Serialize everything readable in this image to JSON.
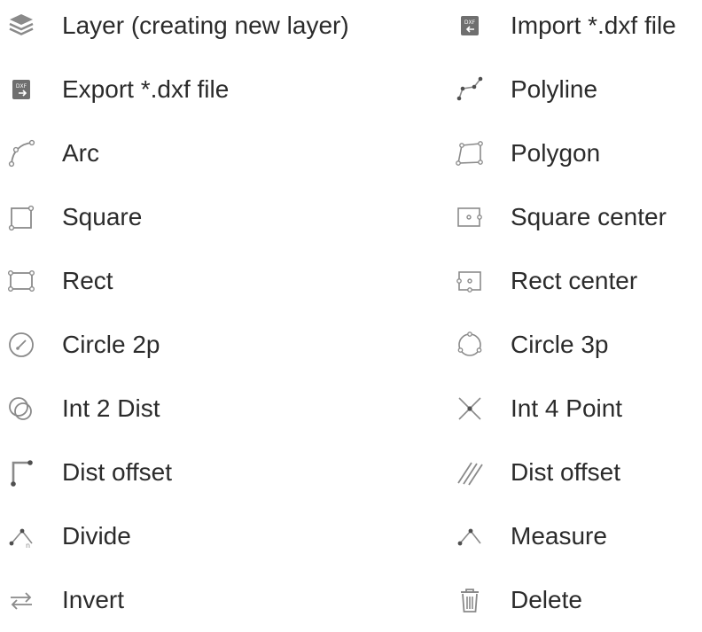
{
  "icon_color": "#8a8a8a",
  "menu": {
    "left": [
      {
        "label": "Layer (creating new layer)",
        "icon": "layers-icon"
      },
      {
        "label": "Export *.dxf file",
        "icon": "dxf-export-icon"
      },
      {
        "label": "Arc",
        "icon": "arc-icon"
      },
      {
        "label": "Square",
        "icon": "square-icon"
      },
      {
        "label": "Rect",
        "icon": "rect-icon"
      },
      {
        "label": "Circle 2p",
        "icon": "circle-2p-icon"
      },
      {
        "label": "Int 2 Dist",
        "icon": "int-2-dist-icon"
      },
      {
        "label": "Dist offset",
        "icon": "dist-offset-icon"
      },
      {
        "label": "Divide",
        "icon": "divide-icon"
      },
      {
        "label": "Invert",
        "icon": "invert-icon"
      }
    ],
    "right": [
      {
        "label": "Import *.dxf file",
        "icon": "dxf-import-icon"
      },
      {
        "label": "Polyline",
        "icon": "polyline-icon"
      },
      {
        "label": "Polygon",
        "icon": "polygon-icon"
      },
      {
        "label": "Square center",
        "icon": "square-center-icon"
      },
      {
        "label": "Rect center",
        "icon": "rect-center-icon"
      },
      {
        "label": "Circle 3p",
        "icon": "circle-3p-icon"
      },
      {
        "label": "Int 4 Point",
        "icon": "int-4-point-icon"
      },
      {
        "label": "Dist offset",
        "icon": "parallel-offset-icon"
      },
      {
        "label": "Measure",
        "icon": "measure-icon"
      },
      {
        "label": "Delete",
        "icon": "trash-icon"
      }
    ]
  }
}
